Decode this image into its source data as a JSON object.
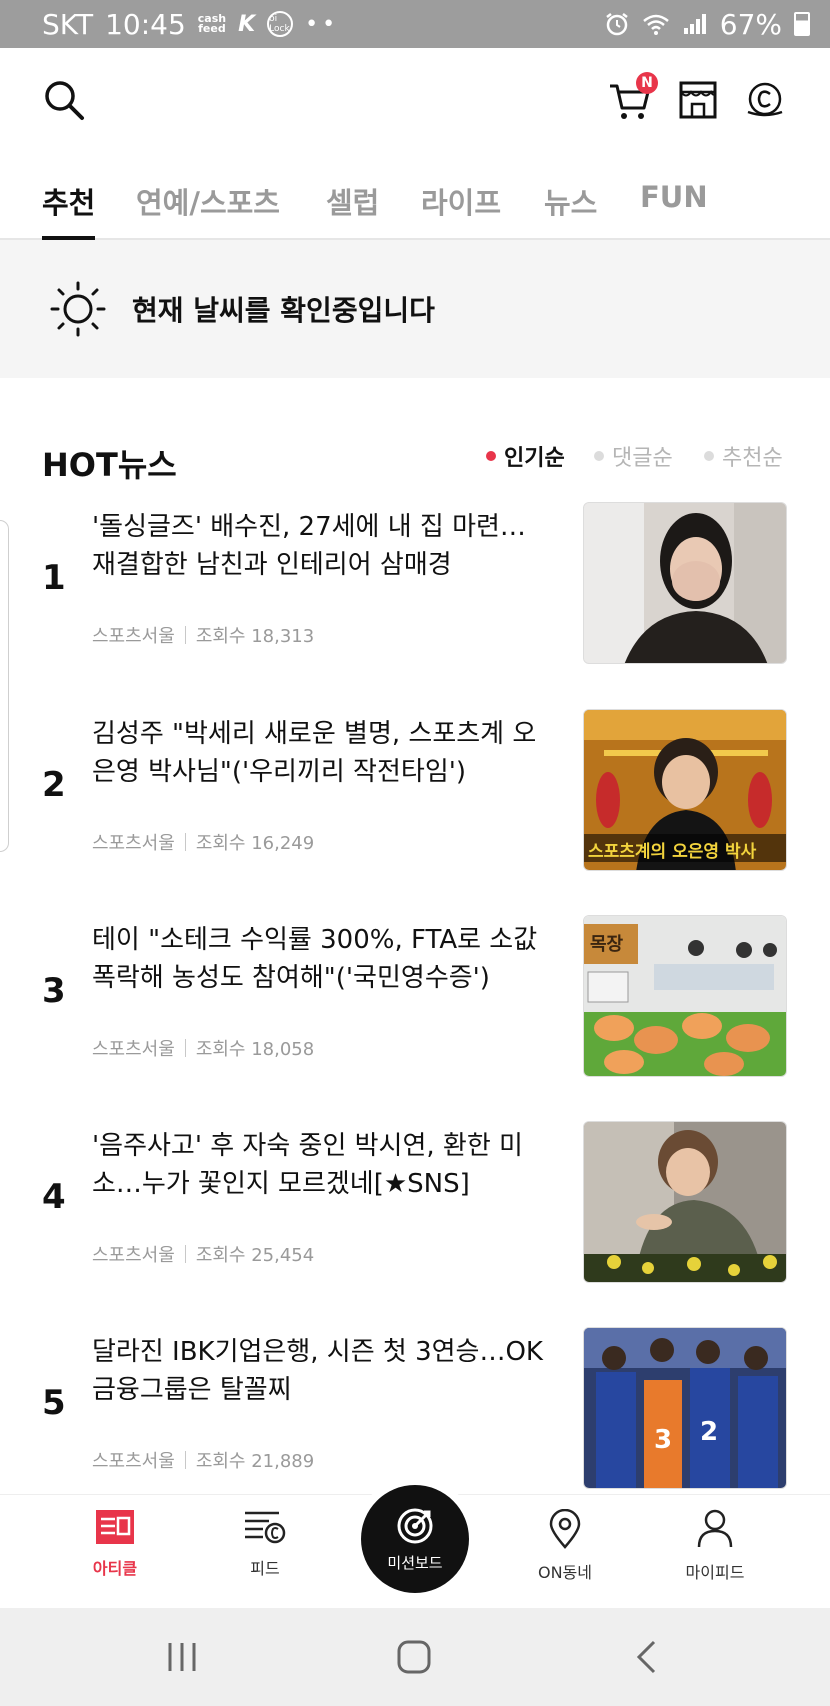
{
  "status_bar": {
    "carrier": "SKT",
    "time": "10:45",
    "cashfeed_line1": "cash",
    "cashfeed_line2": "feed",
    "lock_icon_text": "oi Lock",
    "battery": "67%"
  },
  "header": {
    "cart_badge": "N"
  },
  "tabs": [
    {
      "label": "추천"
    },
    {
      "label": "연예/스포츠"
    },
    {
      "label": "셀럽"
    },
    {
      "label": "라이프"
    },
    {
      "label": "뉴스"
    },
    {
      "label": "FUN"
    }
  ],
  "weather": {
    "text": "현재 날씨를 확인중입니다"
  },
  "hot_news": {
    "title": "HOT뉴스",
    "sort_options": [
      {
        "label": "인기순"
      },
      {
        "label": "댓글순"
      },
      {
        "label": "추천순"
      }
    ],
    "items": [
      {
        "rank": "1",
        "title": "'돌싱글즈' 배수진, 27세에 내 집 마련… 재결합한 남친과 인테리어 삼매경",
        "source": "스포츠서울",
        "views": "조회수 18,313"
      },
      {
        "rank": "2",
        "title": "김성주 \"박세리 새로운 별명, 스포츠계 오은영 박사님\"('우리끼리 작전타임')",
        "source": "스포츠서울",
        "views": "조회수 16,249"
      },
      {
        "rank": "3",
        "title": "테이 \"소테크 수익률 300%, FTA로 소값 폭락해 농성도 참여해\"('국민영수증')",
        "source": "스포츠서울",
        "views": "조회수 18,058"
      },
      {
        "rank": "4",
        "title": "'음주사고' 후 자숙 중인 박시연, 환한 미소…누가 꽃인지 모르겠네[★SNS]",
        "source": "스포츠서울",
        "views": "조회수 25,454"
      },
      {
        "rank": "5",
        "title": "달라진 IBK기업은행, 시즌 첫 3연승…OK금융그룹은 탈꼴찌",
        "source": "스포츠서울",
        "views": "조회수 21,889"
      }
    ]
  },
  "thumbs": {
    "t2_caption": "스포츠계의 오은영 박사",
    "t3_caption": "목장"
  },
  "bottom_nav": {
    "article": "아티클",
    "feed": "피드",
    "mission": "미션보드",
    "on_town": "ON동네",
    "my_feed": "마이피드"
  },
  "colors": {
    "accent": "#e8354a",
    "status_bar": "#9d9d9d"
  }
}
